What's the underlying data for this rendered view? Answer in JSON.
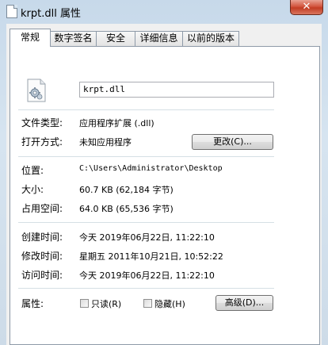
{
  "window": {
    "title": "krpt.dll 属性",
    "close_label": "✕"
  },
  "tabs": [
    {
      "label": "常规",
      "active": true
    },
    {
      "label": "数字签名",
      "active": false
    },
    {
      "label": "安全",
      "active": false
    },
    {
      "label": "详细信息",
      "active": false
    },
    {
      "label": "以前的版本",
      "active": false
    }
  ],
  "general": {
    "file_name": "krpt.dll",
    "file_type_label": "文件类型:",
    "file_type_value": "应用程序扩展 (.dll)",
    "open_with_label": "打开方式:",
    "open_with_value": "未知应用程序",
    "change_button": "更改(C)...",
    "location_label": "位置:",
    "location_value": "C:\\Users\\Administrator\\Desktop",
    "size_label": "大小:",
    "size_value": "60.7 KB (62,184 字节)",
    "disk_size_label": "占用空间:",
    "disk_size_value": "64.0 KB (65,536 字节)",
    "created_label": "创建时间:",
    "created_value": "今天 2019年06月22日, 11:22:10",
    "modified_label": "修改时间:",
    "modified_value": "星期五 2011年10月21日, 10:52:22",
    "accessed_label": "访问时间:",
    "accessed_value": "今天 2019年06月22日, 11:22:10",
    "attributes_label": "属性:",
    "readonly_label": "只读(R)",
    "hidden_label": "隐藏(H)",
    "advanced_button": "高级(D)...",
    "readonly_checked": false,
    "hidden_checked": false
  },
  "icons": {
    "title": "file-icon",
    "file": "gear-file-icon",
    "close": "close-icon"
  }
}
